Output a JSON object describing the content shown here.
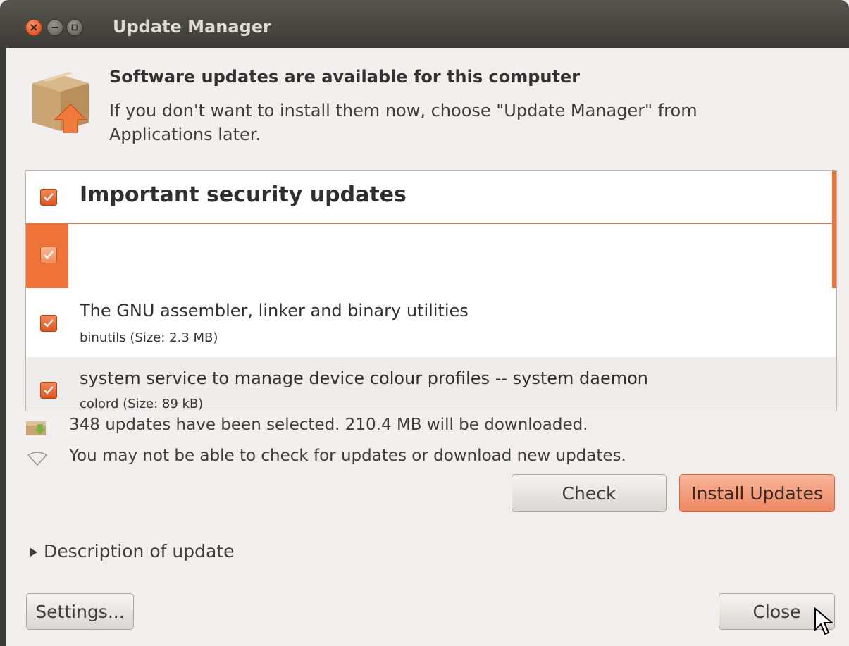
{
  "window": {
    "title": "Update Manager",
    "buttons": [
      "close-icon",
      "minimize-icon",
      "maximize-icon"
    ]
  },
  "header": {
    "icon": "package-update-icon",
    "title": "Software updates are available for this computer",
    "subtitle": "If you don't want to install them now, choose \"Update Manager\" from Applications later."
  },
  "update_list": {
    "group_label": "Important security updates",
    "group_checked": true,
    "items": [
      {
        "title": "",
        "subtitle": "",
        "checked": true,
        "selected": true
      },
      {
        "title": "The GNU assembler, linker and binary utilities",
        "subtitle": "binutils (Size: 2.3 MB)",
        "checked": true
      },
      {
        "title": "system service to manage device colour profiles -- system daemon",
        "subtitle": "colord (Size: 89 kB)",
        "checked": true
      }
    ]
  },
  "status": {
    "selection_summary": "348 updates have been selected. 210.4 MB will be downloaded.",
    "network_warning": "You may not be able to check for updates or download new updates."
  },
  "actions": {
    "check_label": "Check",
    "install_label": "Install Updates",
    "description_expander": "Description of update",
    "settings_label": "Settings...",
    "close_label": "Close"
  },
  "colors": {
    "accent": "#ef7238",
    "titlebar": "#3c3b37",
    "window_bg": "#f2eeee"
  }
}
